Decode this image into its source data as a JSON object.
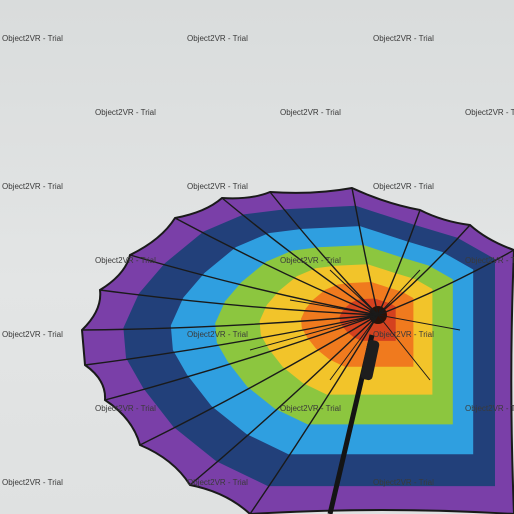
{
  "watermark": {
    "text": "Object2VR -  Trial"
  },
  "umbrella": {
    "colors": [
      "#d4411f",
      "#f07a1e",
      "#f2c42a",
      "#8cc63f",
      "#2f9fe0",
      "#22407a",
      "#7a3fa8"
    ],
    "rib_color": "#1a1a1a"
  },
  "background_color": "#e0e2e2"
}
